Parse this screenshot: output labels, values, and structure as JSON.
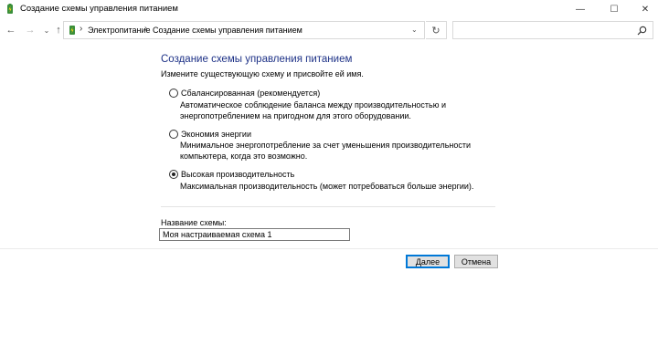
{
  "window": {
    "title": "Создание схемы управления питанием",
    "icons": {
      "app": "power-plan-app-icon",
      "minimize": "minimize-icon",
      "maximize": "maximize-icon",
      "close": "close-icon"
    },
    "controls": {
      "minimize": "—",
      "maximize": "☐",
      "close": "✕"
    }
  },
  "nav": {
    "back_glyph": "←",
    "forward_glyph": "→",
    "history_glyph": "⌄",
    "up_glyph": "↑",
    "refresh_glyph": "↻",
    "dropdown_glyph": "⌄",
    "separator_glyph": "›"
  },
  "breadcrumb": {
    "items": [
      "Электропитание",
      "Создание схемы управления питанием"
    ]
  },
  "search": {
    "placeholder": "",
    "value": ""
  },
  "main": {
    "heading": "Создание схемы управления питанием",
    "subtitle": "Измените существующую схему и присвойте ей имя.",
    "options": [
      {
        "label": "Сбалансированная (рекомендуется)",
        "description": "Автоматическое соблюдение баланса между производительностью и энергопотреблением на пригодном для этого оборудовании.",
        "checked": false
      },
      {
        "label": "Экономия энергии",
        "description": "Минимальное энергопотребление за счет уменьшения производительности компьютера, когда это возможно.",
        "checked": false
      },
      {
        "label": "Высокая производительность",
        "description": "Максимальная производительность (может потребоваться больше энергии).",
        "checked": true
      }
    ],
    "name_label": "Название схемы:",
    "name_value": "Моя настраиваемая схема 1"
  },
  "buttons": {
    "next_label": "Далее",
    "cancel_label": "Отмена"
  },
  "colors": {
    "heading": "#1e3287",
    "default_button_border": "#0078d7",
    "button_bg": "#e1e1e1"
  }
}
